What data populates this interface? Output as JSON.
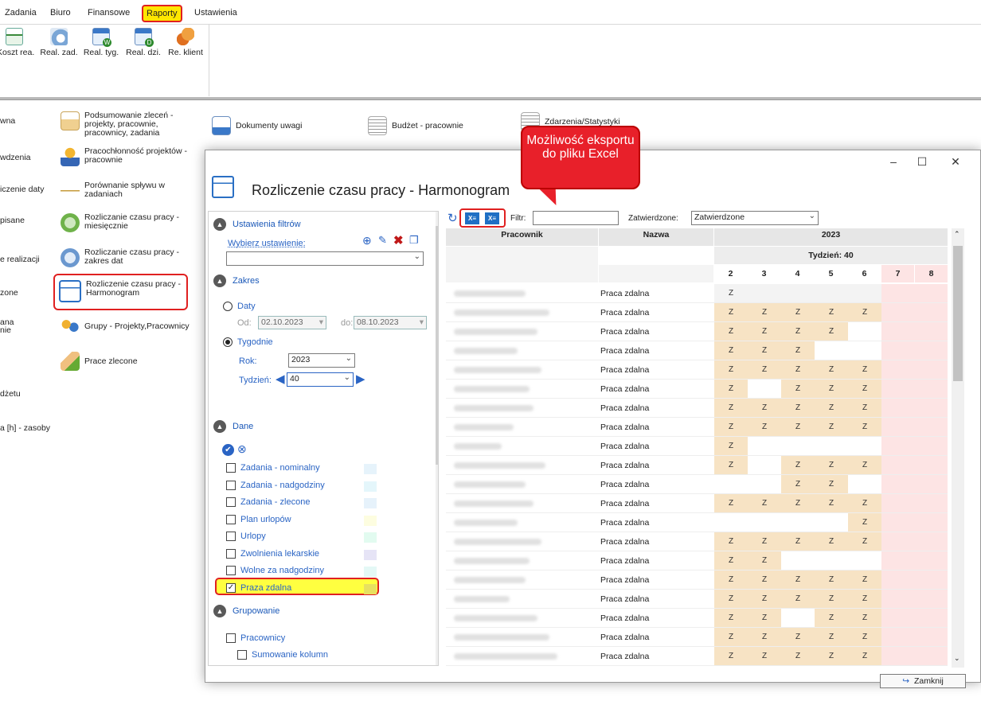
{
  "menu": {
    "items": [
      "Zadania",
      "Biuro",
      "Finansowe",
      "Raporty",
      "Ustawienia"
    ],
    "active": "Raporty"
  },
  "ribbon": {
    "buttons": [
      "Koszt rea.",
      "Real. zad.",
      "Real. tyg.",
      "Real. dzi.",
      "Re. klient"
    ]
  },
  "reports": {
    "left_cut": [
      "wna",
      "wdzenia",
      "iczenie  daty",
      "pisane",
      "e realizacji",
      "zone",
      "ana",
      "nie",
      "dżetu",
      "a [h] - zasoby"
    ],
    "col2": [
      "Podsumowanie zleceń - projekty, pracownie, pracownicy, zadania",
      "Pracochłonność projektów - pracownie",
      "Porównanie spływu w zadaniach",
      "Rozliczanie czasu pracy - miesięcznie",
      "Rozliczanie czasu pracy - zakres dat",
      "Rozliczenie czasu pracy - Harmonogram",
      "Grupy - Projekty,Pracownicy",
      "Prace zlecone"
    ],
    "col3": [
      "Dokumenty uwagi"
    ],
    "col4": [
      "Budżet - pracownie"
    ],
    "col5": [
      "Zdarzenia/Statystyki"
    ]
  },
  "callout": {
    "text": "Możliwość eksportu do pliku Excel"
  },
  "dialog": {
    "title": "Rozliczenie czasu pracy - Harmonogram",
    "win_minimize": "–",
    "win_maximize": "☐",
    "win_close": "✕",
    "close_button": "Zamknij"
  },
  "filters": {
    "settings_header": "Ustawienia filtrów",
    "choose_setting": "Wybierz ustawienie:",
    "range_header": "Zakres",
    "dates_label": "Daty",
    "from_label": "Od:",
    "from_value": "02.10.2023",
    "to_label": "do:",
    "to_value": "08.10.2023",
    "weeks_label": "Tygodnie",
    "year_label": "Rok:",
    "year_value": "2023",
    "week_label": "Tydzień:",
    "week_value": "40",
    "data_header": "Dane",
    "data_items": [
      {
        "label": "Zadania - nominalny",
        "checked": false,
        "color": "#e6f3fb"
      },
      {
        "label": "Zadania - nadgodziny",
        "checked": false,
        "color": "#e4f6fb"
      },
      {
        "label": "Zadania - zlecone",
        "checked": false,
        "color": "#e6f2fb"
      },
      {
        "label": "Plan urlopów",
        "checked": false,
        "color": "#fdfde0"
      },
      {
        "label": "Urlopy",
        "checked": false,
        "color": "#e2fbf0"
      },
      {
        "label": "Zwolnienia lekarskie",
        "checked": false,
        "color": "#e6e4f6"
      },
      {
        "label": "Wolne za nadgodziny",
        "checked": false,
        "color": "#e4f8f6"
      },
      {
        "label": "Praza zdalna",
        "checked": true,
        "color": "#e8e060"
      }
    ],
    "grouping_header": "Grupowanie",
    "group_workers": "Pracownicy",
    "group_sum_columns": "Sumowanie kolumn"
  },
  "toolbar": {
    "filter_label": "Filtr:",
    "filter_value": "",
    "approved_label": "Zatwierdzone:",
    "approved_value": "Zatwierdzone"
  },
  "grid": {
    "col_worker": "Pracownik",
    "col_name": "Nazwa",
    "year": "2023",
    "week": "Tydzień: 40",
    "days": [
      "2",
      "3",
      "4",
      "5",
      "6",
      "7",
      "8"
    ],
    "rows": [
      {
        "type": "Praca zdalna",
        "z": [
          1,
          0,
          0,
          0,
          0
        ]
      },
      {
        "type": "Praca zdalna",
        "z": [
          1,
          1,
          1,
          1,
          1
        ]
      },
      {
        "type": "Praca zdalna",
        "z": [
          1,
          1,
          1,
          1,
          0
        ]
      },
      {
        "type": "Praca zdalna",
        "z": [
          1,
          1,
          1,
          0,
          0
        ]
      },
      {
        "type": "Praca zdalna",
        "z": [
          1,
          1,
          1,
          1,
          1
        ]
      },
      {
        "type": "Praca zdalna",
        "z": [
          1,
          0,
          1,
          1,
          1
        ]
      },
      {
        "type": "Praca zdalna",
        "z": [
          1,
          1,
          1,
          1,
          1
        ]
      },
      {
        "type": "Praca zdalna",
        "z": [
          1,
          1,
          1,
          1,
          1
        ]
      },
      {
        "type": "Praca zdalna",
        "z": [
          1,
          0,
          0,
          0,
          0
        ]
      },
      {
        "type": "Praca zdalna",
        "z": [
          1,
          0,
          1,
          1,
          1
        ]
      },
      {
        "type": "Praca zdalna",
        "z": [
          0,
          0,
          1,
          1,
          0
        ]
      },
      {
        "type": "Praca zdalna",
        "z": [
          1,
          1,
          1,
          1,
          1
        ]
      },
      {
        "type": "Praca zdalna",
        "z": [
          0,
          0,
          0,
          0,
          1
        ]
      },
      {
        "type": "Praca zdalna",
        "z": [
          1,
          1,
          1,
          1,
          1
        ]
      },
      {
        "type": "Praca zdalna",
        "z": [
          1,
          1,
          0,
          0,
          0
        ]
      },
      {
        "type": "Praca zdalna",
        "z": [
          1,
          1,
          1,
          1,
          1
        ]
      },
      {
        "type": "Praca zdalna",
        "z": [
          1,
          1,
          1,
          1,
          1
        ]
      },
      {
        "type": "Praca zdalna",
        "z": [
          1,
          1,
          0,
          1,
          1
        ]
      },
      {
        "type": "Praca zdalna",
        "z": [
          1,
          1,
          1,
          1,
          1
        ]
      },
      {
        "type": "Praca zdalna",
        "z": [
          1,
          1,
          1,
          1,
          1
        ]
      }
    ],
    "z_label": "Z"
  },
  "colors": {
    "remote_cell": "#f7e3c4",
    "weekend": "#fde4e4",
    "callout": "#e8202a",
    "highlight": "#ffff40"
  }
}
